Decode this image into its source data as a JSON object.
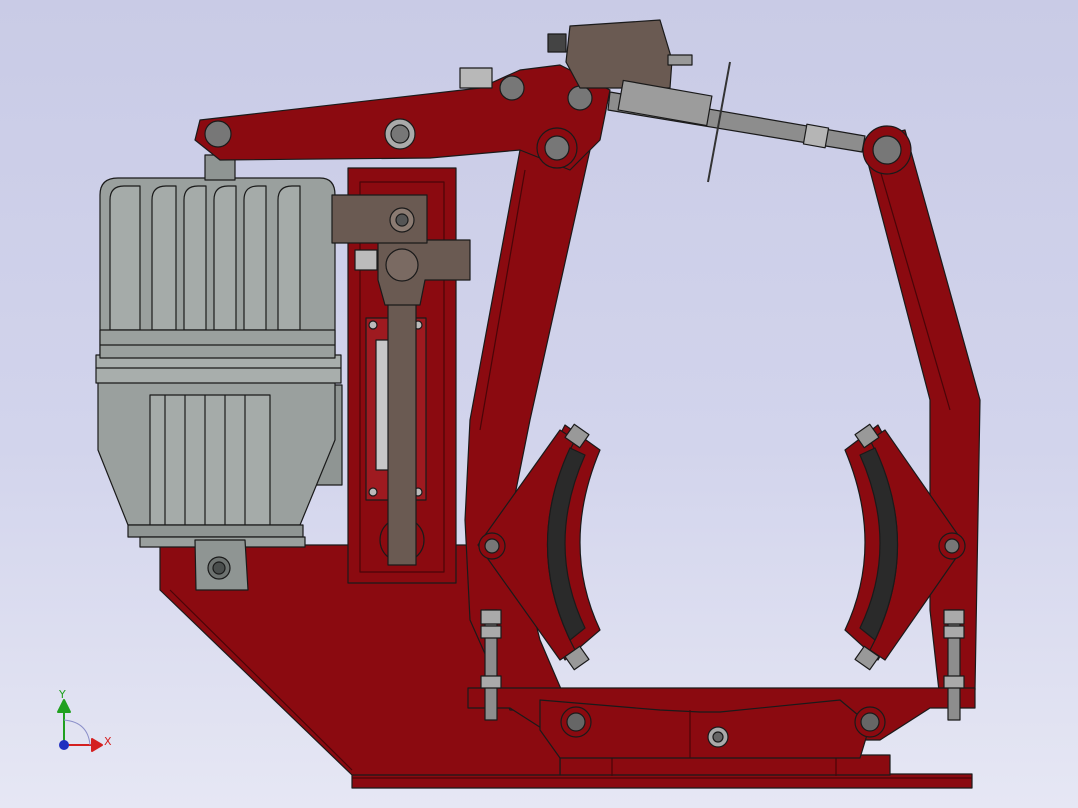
{
  "viewport": {
    "colors": {
      "background_top": "#c9cbe6",
      "background_bottom": "#e6e7f4",
      "frame_red": "#8b0a10",
      "motor_gray": "#9aa09e",
      "rod_brown": "#6a5a52",
      "shoe_lining": "#2a2a2a",
      "bolt_gray": "#a8a8a8",
      "edge": "#1a1a1a"
    }
  },
  "triad": {
    "y_label": "Y",
    "x_label": "X",
    "colors": {
      "x": "#d42020",
      "y": "#20a020",
      "z": "#2030c0"
    }
  }
}
